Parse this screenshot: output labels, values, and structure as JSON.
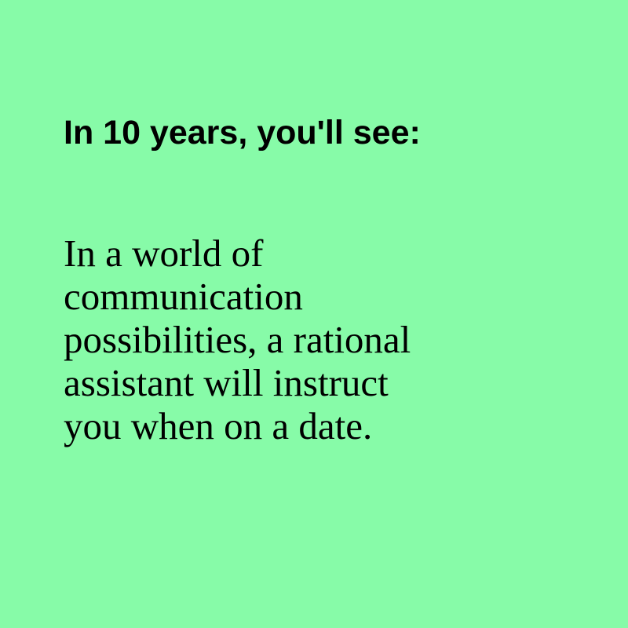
{
  "heading": "In 10 years, you'll see:",
  "body": {
    "lines": [
      "In a world of",
      "communication",
      "possibilities, a rational",
      "assistant will instruct",
      "you when on a date."
    ]
  },
  "colors": {
    "background": "#87fba8",
    "text": "#000000"
  }
}
